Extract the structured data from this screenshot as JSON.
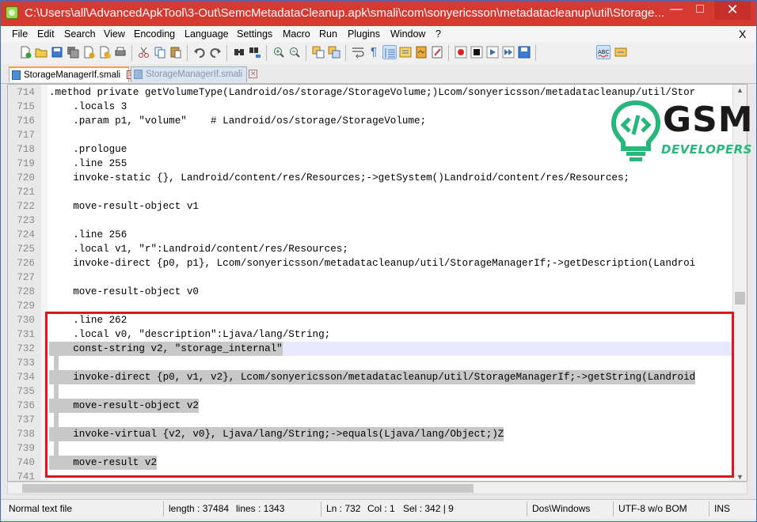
{
  "window": {
    "title": "C:\\Users\\all\\AdvancedApkTool\\3-Out\\SemcMetadataCleanup.apk\\smali\\com\\sonyericsson\\metadatacleanup\\util\\Storage...",
    "min_label": "—",
    "max_label": "□",
    "close_label": "✕"
  },
  "menu": {
    "items": [
      "File",
      "Edit",
      "Search",
      "View",
      "Encoding",
      "Language",
      "Settings",
      "Macro",
      "Run",
      "Plugins",
      "Window",
      "?"
    ],
    "close_label": "X"
  },
  "toolbar": {
    "icons": [
      "new-file-icon",
      "open-file-icon",
      "save-icon",
      "save-all-icon",
      "close-icon",
      "close-all-icon",
      "print-icon",
      "cut-icon",
      "copy-icon",
      "paste-icon",
      "undo-icon",
      "redo-icon",
      "find-icon",
      "replace-icon",
      "zoom-in-icon",
      "zoom-out-icon",
      "sync-vertical-icon",
      "sync-horizontal-icon",
      "word-wrap-icon",
      "show-all-chars-icon",
      "indent-guide-icon",
      "function-list-icon",
      "doc-map-icon",
      "folder-workspace-icon",
      "record-macro-icon",
      "stop-macro-icon",
      "play-macro-icon",
      "run-macro-multiple-icon",
      "save-macro-icon",
      "spell-check-icon",
      "auto-complete-icon"
    ]
  },
  "tabs": [
    {
      "label": "StorageManagerIf.smali",
      "close": "✕",
      "active": true
    },
    {
      "label": "StorageManagerIf.smali",
      "close": "✕",
      "active": false
    }
  ],
  "editor": {
    "lines": [
      {
        "n": "714",
        "code": ".method private getVolumeType(Landroid/os/storage/StorageVolume;)Lcom/sonyericsson/metadatacleanup/util/Stor"
      },
      {
        "n": "715",
        "code": "    .locals 3"
      },
      {
        "n": "716",
        "code": "    .param p1, \"volume\"    # Landroid/os/storage/StorageVolume;"
      },
      {
        "n": "717",
        "code": ""
      },
      {
        "n": "718",
        "code": "    .prologue"
      },
      {
        "n": "719",
        "code": "    .line 255"
      },
      {
        "n": "720",
        "code": "    invoke-static {}, Landroid/content/res/Resources;->getSystem()Landroid/content/res/Resources;"
      },
      {
        "n": "721",
        "code": ""
      },
      {
        "n": "722",
        "code": "    move-result-object v1"
      },
      {
        "n": "723",
        "code": ""
      },
      {
        "n": "724",
        "code": "    .line 256"
      },
      {
        "n": "725",
        "code": "    .local v1, \"r\":Landroid/content/res/Resources;"
      },
      {
        "n": "726",
        "code": "    invoke-direct {p0, p1}, Lcom/sonyericsson/metadatacleanup/util/StorageManagerIf;->getDescription(Landroi"
      },
      {
        "n": "727",
        "code": ""
      },
      {
        "n": "728",
        "code": "    move-result-object v0"
      },
      {
        "n": "729",
        "code": ""
      },
      {
        "n": "730",
        "code": "    .line 262"
      },
      {
        "n": "731",
        "code": "    .local v0, \"description\":Ljava/lang/String;"
      },
      {
        "n": "732",
        "code": "    const-string v2, \"storage_internal\""
      },
      {
        "n": "733",
        "code": ""
      },
      {
        "n": "734",
        "code": "    invoke-direct {p0, v1, v2}, Lcom/sonyericsson/metadatacleanup/util/StorageManagerIf;->getString(Landroid"
      },
      {
        "n": "735",
        "code": ""
      },
      {
        "n": "736",
        "code": "    move-result-object v2"
      },
      {
        "n": "737",
        "code": ""
      },
      {
        "n": "738",
        "code": "    invoke-virtual {v2, v0}, Ljava/lang/String;->equals(Ljava/lang/Object;)Z"
      },
      {
        "n": "739",
        "code": ""
      },
      {
        "n": "740",
        "code": "    move-result v2"
      },
      {
        "n": "741",
        "code": ""
      }
    ],
    "selected_lines": [
      "732",
      "733",
      "734",
      "735",
      "736",
      "737",
      "738",
      "739",
      "740"
    ],
    "current_line": "732"
  },
  "logo": {
    "brand": "GSM",
    "tagline": "DEVELOPERS",
    "accent_color": "#27b77a"
  },
  "highlight_color": "#e3141d",
  "status": {
    "file_type": "Normal text file",
    "length": "length : 37484",
    "lines": "lines : 1343",
    "ln": "Ln : 732",
    "col": "Col : 1",
    "sel": "Sel : 342 | 9",
    "eol": "Dos\\Windows",
    "encoding": "UTF-8 w/o BOM",
    "mode": "INS"
  }
}
